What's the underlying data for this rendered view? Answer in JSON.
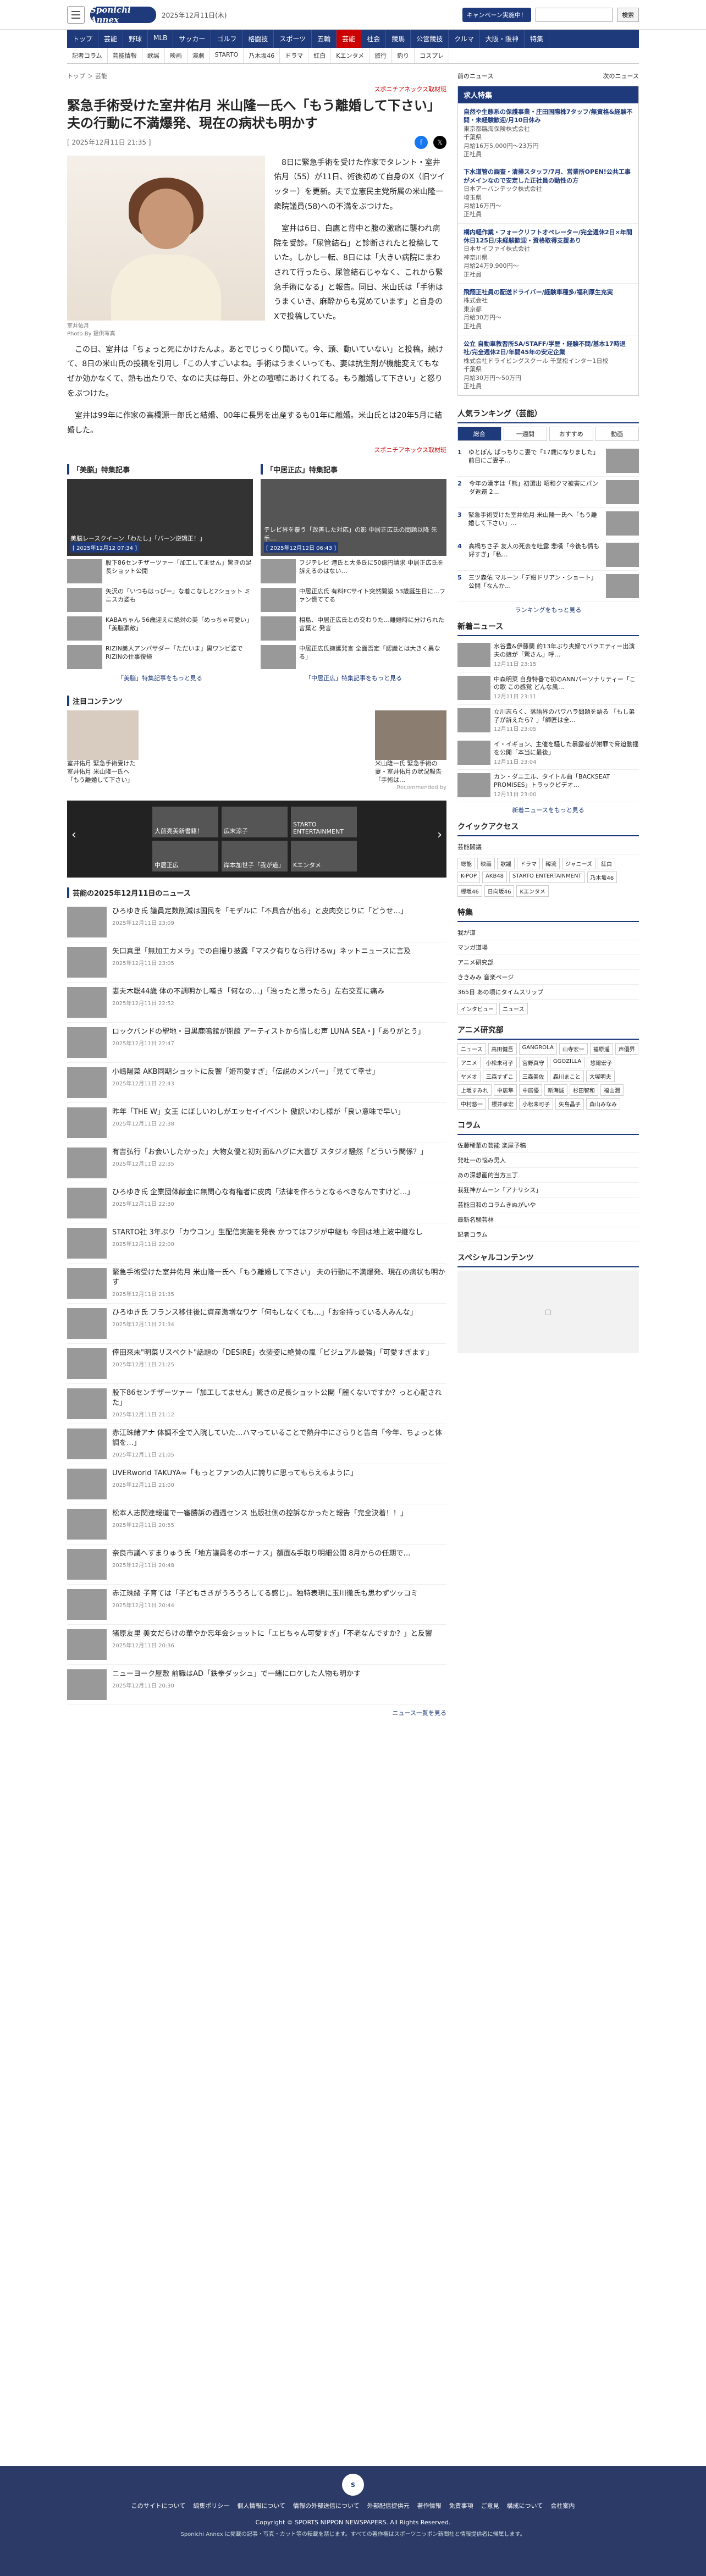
{
  "header": {
    "logo": "Sponichi Annex",
    "date": "2025年12月11日(木)",
    "campaign": "キャンペーン実施中！",
    "search_placeholder": "",
    "search_btn": "検索"
  },
  "gnav": [
    "トップ",
    "芸能",
    "野球",
    "MLB",
    "サッカー",
    "ゴルフ",
    "格闘技",
    "スポーツ",
    "五輪",
    "芸能",
    "社会",
    "競馬",
    "公営競技",
    "クルマ",
    "大阪・阪神",
    "特集"
  ],
  "subnav": [
    "記者コラム",
    "芸能情報",
    "歌謡",
    "映画",
    "演劇",
    "STARTO",
    "乃木坂46",
    "ドラマ",
    "紅白",
    "Kエンタメ",
    "旅行",
    "釣り",
    "コスプレ"
  ],
  "crumb": "トップ ＞ 芸能",
  "article": {
    "source": "スポニチアネックス取材班",
    "title": "緊急手術受けた室井佑月 米山隆一氏へ「もう離婚して下さい」 夫の行動に不満爆発、現在の病状も明かす",
    "date": "[ 2025年12月11日 21:35 ]",
    "caption1": "室井佑月",
    "caption2": "Photo By 提供写真",
    "p1": "8日に緊急手術を受けた作家でタレント・室井佑月（55）が11日、術後初めて自身のX（旧ツイッター）を更新。夫で立憲民主党所属の米山隆一衆院議員(58)への不満をぶつけた。",
    "p2": "室井は6日、白鷹と背中と腹の激痛に襲われ病院を受診。「尿管結石」と診断されたと投稿していた。しかし一転、8日には「大きい病院にまわされて行ったら、尿管結石じゃなく、これから緊急手術になる」と報告。同日、米山氏は「手術はうまくいき、麻酔からも覚めています」と自身のXで投稿していた。",
    "p3": "この日、室井は「ちょっと死にかけたんよ。あとでじっくり聞いて。今、頭、動いていない」と投稿。続けて、8日の米山氏の投稿を引用し「この人すごいよね。手術はうまくいっても、妻は抗生剤が機能変えてもなぜか効かなくて、熱も出たりで、なのに夫は毎日、外との喧嘩にあけくれてる。もう離婚して下さい」と怒りをぶつけた。",
    "p4": "室井は99年に作家の高橋源一郎氏と結婚、00年に長男を出産するも01年に離婚。米山氏とは20年5月に結婚した。",
    "source2": "スポニチアネックス取材班"
  },
  "related": {
    "left_title": "「美脳」特集記事",
    "right_title": "「中居正広」特集記事",
    "left_big": "美脳レースクイーン「わたし」「バーン逆矯正！」",
    "left_time": "[ 2025年12月12 07:34 ]",
    "right_big": "テレビ界を覆う「改善した対応」の影 中居正広氏の問題以降 先手…",
    "right_time": "[ 2025年12月12日 06:43 ]",
    "left_items": [
      "股下86センチザーツァー「加工してません」驚きの足長ショット公開",
      "矢沢の「いつもはっぴー」な着こなしと2ショット ミニスカ姿も",
      "KABAちゃん 56歳迎えに絶対の美「めっちゃ可愛い」「美脳素敵」",
      "RIZIN美人アンバサダー「ただいま」黒ワンピ姿でRIZINの仕事復帰"
    ],
    "right_items": [
      "フジテレビ 港氏と大多氏に50億円請求 中居正広氏を訴えるのはない…",
      "中居正広氏 有料FCサイト突然開設 53歳誕生日に…ファン慌ててる",
      "相島、中居正広氏との交わりた…離婚時に分けられた言葉と 発言",
      "中居正広氏擁護発言 全面否定「認識とは大きく異なる」"
    ],
    "more_left": "「美脳」特集記事をもっと見る",
    "more_right": "「中居正広」特集記事をもっと見る"
  },
  "attention": {
    "title": "注目コンテンツ",
    "items": [
      "室井佑月 緊急手術受けた室井佑月 米山隆一氏へ「もう離婚して下さい」",
      "米山隆一氏 緊急手術の妻・室井佑月の状況報告「手術は…"
    ],
    "rec": "Recommended by"
  },
  "carousel": [
    "大前亮美新書籍！",
    "広末涼子",
    "STARTO ENTERTAINMENT",
    "中居正広",
    "岸本加世子「我が道」",
    "Kエンタメ"
  ],
  "news": {
    "title": "芸能の2025年12月11日のニュース",
    "items": [
      [
        "ひろゆき氏 議員定数削減は国民を「モデルに「不具合が出る」と皮肉交じりに「どうせ…」",
        "2025年12月11日 23:09"
      ],
      [
        "矢口真里「無加工カメラ」での自撮り披露「マスク有りなら行けるw」ネットニュースに言及",
        "2025年12月11日 23:05"
      ],
      [
        "妻夫木聡44歳 体の不調明かし嘆き「何なの…」「治ったと思ったら」左右交互に痛み",
        "2025年12月11日 22:52"
      ],
      [
        "ロックバンドの聖地・目黒鹿鳴館が閉館 アーティストから惜しむ声 LUNA SEA・J「ありがとう」",
        "2025年12月11日 22:47"
      ],
      [
        "小嶋陽菜 AKB同期ショットに反響「姫司愛すぎ」「伝説のメンバー」「見てて幸せ」",
        "2025年12月11日 22:43"
      ],
      [
        "昨年「THE W」女王 にぼしいわしがエッセイイベント 傲訳いわし様が「良い意味で早い」",
        "2025年12月11日 22:38"
      ],
      [
        "有吉弘行「お会いしたかった」大物女優と初対面&ハグに大喜び スタジオ騒然「どういう関係？」",
        "2025年12月11日 22:35"
      ],
      [
        "ひろゆき氏 企業団体献金に無関心な有権者に皮肉「法律を作ろうとなるべきなんですけど…」",
        "2025年12月11日 22:30"
      ],
      [
        "STARTO社 3年ぶり「カウコン」生配信実施を発表 かつてはフジが中継も 今回は地上波中継なし",
        "2025年12月11日 22:00"
      ],
      [
        "緊急手術受けた室井佑月 米山隆一氏へ「もう離婚して下さい」 夫の行動に不満爆発、現在の病状も明かす",
        "2025年12月11日 21:35"
      ],
      [
        "ひろゆき氏 フランス移住後に資産激増なワケ「何もしなくても…」「お金持っている人みんな」",
        "2025年12月11日 21:34"
      ],
      [
        "倖田來未\"明菜リスペクト\"話題の「DESIRE」衣装姿に絶賛の嵐「ビジュアル最強」「可愛すぎます」",
        "2025年12月11日 21:25"
      ],
      [
        "股下86センチザーツァー「加工してません」驚きの足長ショット公開「麗くないですか？っと心配された」",
        "2025年12月11日 21:12"
      ],
      [
        "赤江珠緒アナ 体調不全で入院していた…ハマっていることで熱弁中にさらりと告白「今年、ちょっと体調を…」",
        "2025年12月11日 21:05"
      ],
      [
        "UVERworld TAKUYA∞「もっとファンの人に誇りに思ってもらえるように」",
        "2025年12月11日 21:00"
      ],
      [
        "松本人志関連報道で一審勝訴の週週センス 出版社側の控訴なかったと報告「完全決着！！」",
        "2025年12月11日 20:55"
      ],
      [
        "奈良市議へすまりゅう氏「地方議員冬のボーナス」額面&手取り明細公開 8月からの任期で…",
        "2025年12月11日 20:48"
      ],
      [
        "赤江珠緒 子育ては「子どもさきがうろうろしてる感じ」。独特表現に玉川徹氏も思わずツッコミ",
        "2025年12月11日 20:44"
      ],
      [
        "猪原友里 美女だらけの華やか忘年会ショットに「エビちゃん可愛すぎ」「不老なんですか？」と反響",
        "2025年12月11日 20:36"
      ],
      [
        "ニューヨーク屋敷 前職はAD「鉄拳ダッシュ」で一緒にロケした人物も明かす",
        "2025年12月11日 20:30"
      ]
    ],
    "more": "ニュース一覧を見る"
  },
  "side": {
    "prev": "前のニュース",
    "next": "次のニュース",
    "jobs_title": "求人特集",
    "jobs": [
      [
        "自然や生態系の保護事業・庄田国際株7タッフ/無資格&経験不問・未経験歓迎/月10日休み",
        "東京都臨海保険株式会社",
        "千葉県",
        "月給16万5,000円〜23万円",
        "正社員"
      ],
      [
        "下水道管の調査・清掃スタッフ/7月、営業所OPEN!公共工事がメインなので安定した正社員の動性の方",
        "日本アーバンテック株式会社",
        "埼玉県",
        "月給16万円〜",
        "正社員"
      ],
      [
        "構内軽作業・フォークリフトオペレーター/完全週休2日×年間休日125日/未経験歓迎・資格取得支援あり",
        "日本サイファイ株式会社",
        "神奈川県",
        "月給24万9,900円〜",
        "正社員"
      ],
      [
        "飛翔正社員の配送ドライバー/経験車種多/福利厚生充実",
        "株式会社",
        "東京都",
        "月給30万円〜",
        "正社員"
      ],
      [
        "公立 自動車教習所SA/STAFF/学歴・経験不問/基本17時退社/完全週休2日/年間45年の安定企業",
        "株式会社ドライビングスクール 千葉松インター1日校",
        "千葉県",
        "月給30万円〜50万円",
        "正社員"
      ]
    ],
    "rank_title": "人気ランキング（芸能）",
    "rank_tabs": [
      "総合",
      "一週間",
      "おすすめ",
      "動画"
    ],
    "ranks": [
      "ゆとぽん ぱっちりこ妻で「17歳になりました」 前日にご妻子…",
      "今年の漢字は「熊」初選出 昭和クマ被害にパンダ返還 2…",
      "緊急手術受けた室井佑月 米山隆一氏へ「もう離婚して下さい」…",
      "高橋ちさ子 友人の死去を吐露 悲嘆「今後も情も好すぎ」「私…",
      "三ツ森佑 マルーン「デ紺ドリアン・ショート」公開「なんか…"
    ],
    "rank_more": "ランキングをもっと見る",
    "new_title": "新着ニュース",
    "new_items": [
      [
        "水谷豊&伊藤蘭 約13年ぶり夫婦でバラエティー出演 夫の娘が「驚さん」呼…",
        "12月11日 23:15"
      ],
      [
        "中森明菜 自身特番で初のANNパーソナリティー「この歌 この感覚 どんな風…",
        "12月11日 23:11"
      ],
      [
        "立川志らく、落語界のパワハラ問題を語る 「もし弟子が訴えたら？」「師匠は全…",
        "12月11日 23:05"
      ],
      [
        "イ・イギョン、主催を騒した暴露者が謝罪で脅迫動揺を公開「本当に最後」",
        "12月11日 23:04"
      ],
      [
        "カン・ダニエル、タイトル曲「BACKSEAT PROMISES」トラックビデオ…",
        "12月11日 23:00"
      ]
    ],
    "new_more": "新着ニュースをもっと見る",
    "quick_title": "クイックアクセス",
    "quick_link": "芸能閣議",
    "quick_chips": [
      "総能",
      "映画",
      "歌謡",
      "ドラマ",
      "韓流",
      "ジャニーズ",
      "紅白",
      "K-POP",
      "AKB48",
      "STARTO ENTERTAINMENT",
      "乃木坂46",
      "欅坂46",
      "日向坂46",
      "Kエンタメ"
    ],
    "feature_title": "特集",
    "features": [
      "我が道",
      "マンガ道場",
      "アニメ研究部",
      "ききみみ 音楽ページ",
      "365日 あの頃にタイムスリップ"
    ],
    "feature_extra": [
      "インタビュー",
      "ニュース"
    ],
    "anime_title": "アニメ研究部",
    "anime_chips": [
      "ニュース",
      "高田健吾",
      "GANGROLA",
      "山寺宏一",
      "福原遥",
      "声優界",
      "アニメ",
      "小松未可子",
      "宮野真守",
      "GGOZILLA",
      "悠爾宏子",
      "ヤメオ",
      "三森すずこ",
      "三森美佐",
      "森川まこと",
      "大塚明夫",
      "上坂すみれ",
      "中居隼",
      "中居優",
      "新海誠",
      "杉田智和",
      "福山潤",
      "中村悠一",
      "櫻井孝宏",
      "小松未可子",
      "矢島晶子",
      "森山みなみ"
    ],
    "column_title": "コラム",
    "columns": [
      "佐藤稀華の芸能 楽屋予稿",
      "発吐一の悩み男人",
      "あの深想画的当方三丁",
      "我狂神かムーン「アナリシス」",
      "芸能日和のコラムきぬがいや",
      "最新名騒芸林",
      "記者コラム"
    ],
    "special_title": "スペシャルコンテンツ"
  },
  "footer": {
    "links": [
      "このサイトについて",
      "編集ポリシー",
      "個人情報について",
      "情報の外部送信について",
      "外部配信提供元",
      "著作情報",
      "免責事項",
      "ご意見",
      "構成について",
      "会社案内"
    ],
    "copy": "Copyright © SPORTS NIPPON NEWSPAPERS. All Rights Reserved.",
    "note": "Sponichi Annex に掲載の記事・写真・カット等の転載を禁じます。すべての著作権はスポーツニッポン新聞社と情報提供者に帰属します。"
  }
}
